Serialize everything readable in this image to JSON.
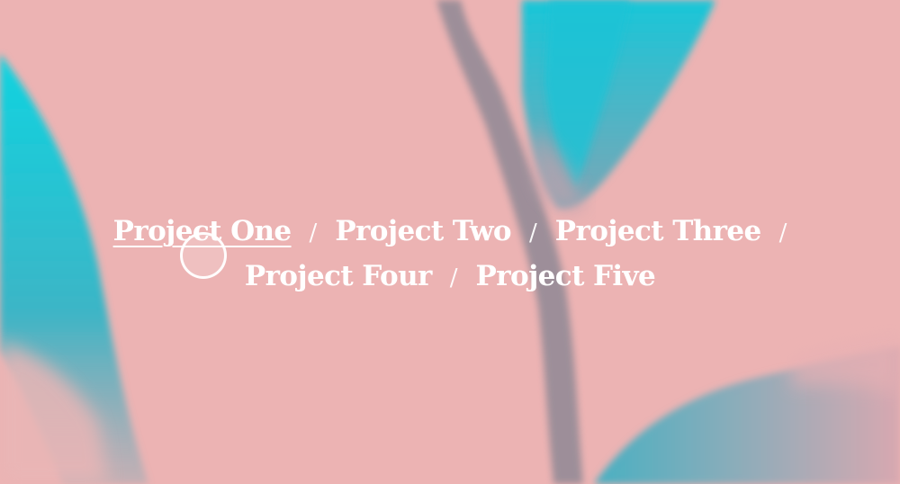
{
  "nav": {
    "row1": [
      {
        "label": "Project One",
        "active": true
      },
      {
        "label": "Project Two",
        "active": false
      },
      {
        "label": "Project Three",
        "active": false
      }
    ],
    "row2": [
      {
        "label": "Project Four",
        "active": false
      },
      {
        "label": "Project Five",
        "active": false
      }
    ],
    "separator": "/"
  },
  "colors": {
    "background": "#ecb3b3",
    "foliage": "#3bbfcf",
    "stem": "#9a8a95",
    "text": "#ffffff"
  },
  "cursor": {
    "icon": "cursor-circle-icon"
  }
}
